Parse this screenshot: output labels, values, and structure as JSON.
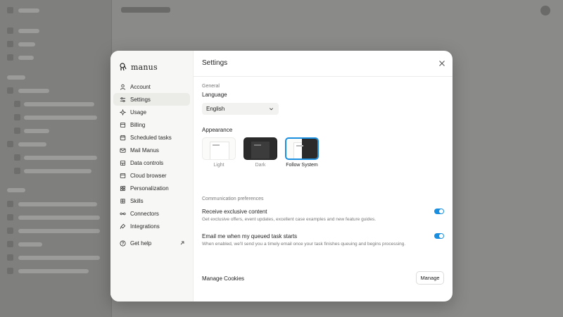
{
  "brand": {
    "name": "manus"
  },
  "sidebar": {
    "items": [
      {
        "label": "Account",
        "icon": "user-icon",
        "active": false
      },
      {
        "label": "Settings",
        "icon": "sliders-icon",
        "active": true
      },
      {
        "label": "Usage",
        "icon": "sparkle-icon",
        "active": false
      },
      {
        "label": "Billing",
        "icon": "billing-icon",
        "active": false
      },
      {
        "label": "Scheduled tasks",
        "icon": "calendar-icon",
        "active": false
      },
      {
        "label": "Mail Manus",
        "icon": "mail-icon",
        "active": false
      },
      {
        "label": "Data controls",
        "icon": "database-icon",
        "active": false
      },
      {
        "label": "Cloud browser",
        "icon": "monitor-icon",
        "active": false
      },
      {
        "label": "Personalization",
        "icon": "personalization-icon",
        "active": false
      },
      {
        "label": "Skills",
        "icon": "skills-icon",
        "active": false
      },
      {
        "label": "Connectors",
        "icon": "connector-icon",
        "active": false
      },
      {
        "label": "Integrations",
        "icon": "integrations-icon",
        "active": false
      }
    ],
    "help": {
      "label": "Get help"
    }
  },
  "settings": {
    "title": "Settings",
    "general": "General",
    "language_label": "Language",
    "language_value": "English",
    "appearance_label": "Appearance",
    "themes": [
      {
        "name": "Light",
        "selected": false
      },
      {
        "name": "Dark",
        "selected": false
      },
      {
        "name": "Follow System",
        "selected": true
      }
    ],
    "communication_label": "Communication preferences",
    "prefs": [
      {
        "title": "Receive exclusive content",
        "desc": "Get exclusive offers, event updates, excellent case examples and new feature guides.",
        "enabled": true
      },
      {
        "title": "Email me when my queued task starts",
        "desc": "When enabled, we'll send you a timely email once your task finishes queuing and begins processing.",
        "enabled": true
      }
    ],
    "cookies_label": "Manage Cookies",
    "manage_button": "Manage"
  },
  "colors": {
    "accent": "#1a8fe0",
    "modal_bg": "#ffffff",
    "sidebar_bg": "#f7f7f5"
  }
}
